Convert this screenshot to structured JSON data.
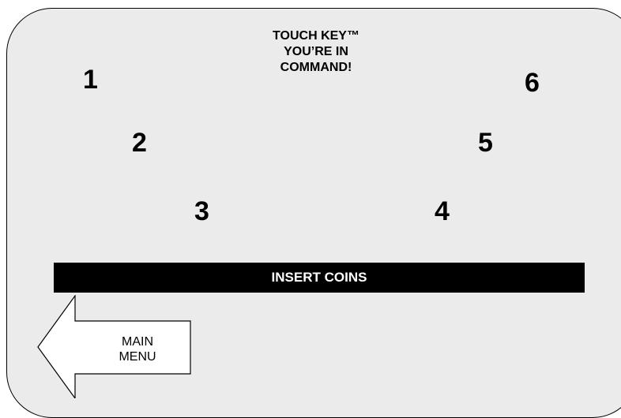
{
  "header": {
    "title_lines": [
      "TOUCH KEY™",
      "YOU’RE IN",
      "COMMAND!"
    ]
  },
  "keys": [
    "1",
    "2",
    "3",
    "4",
    "5",
    "6"
  ],
  "status_bar": {
    "text": "INSERT COINS"
  },
  "navigation": {
    "main_menu_lines": [
      "MAIN",
      "MENU"
    ],
    "main_menu_icon": "left-arrow-icon"
  },
  "colors": {
    "screen_background": "#ebebeb",
    "bar_background": "#000000",
    "bar_text": "#ffffff"
  }
}
